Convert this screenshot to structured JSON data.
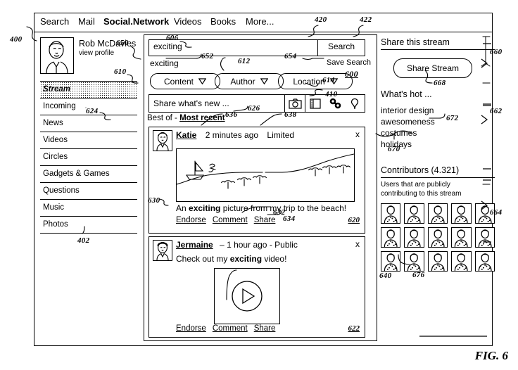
{
  "figure": {
    "label": "FIG. 6",
    "main_ref": "400",
    "panel_ref": "402",
    "center_ref": "600"
  },
  "topnav": {
    "items": [
      {
        "label": "Search",
        "bold": false
      },
      {
        "label": "Mail",
        "bold": false
      },
      {
        "label": "Social.Network",
        "bold": true
      },
      {
        "label": "Videos",
        "bold": false
      },
      {
        "label": "Books",
        "bold": false
      },
      {
        "label": "More...",
        "bold": false
      }
    ],
    "refs": [
      "420",
      "422"
    ]
  },
  "sidebar": {
    "profile": {
      "name": "Rob McDavies",
      "link": "view profile",
      "avatar_icon": "user-portrait-icon"
    },
    "items": [
      {
        "label": "Stream",
        "selected": true
      },
      {
        "label": "Incoming",
        "selected": false
      },
      {
        "label": "News",
        "selected": false
      },
      {
        "label": "Videos",
        "selected": false
      },
      {
        "label": "Circles",
        "selected": false
      },
      {
        "label": "Gadgets & Games",
        "selected": false
      },
      {
        "label": "Questions",
        "selected": false
      },
      {
        "label": "Music",
        "selected": false
      },
      {
        "label": "Photos",
        "selected": false
      }
    ],
    "refs": {
      "profile": "650",
      "stream": "610",
      "incoming": "624"
    }
  },
  "search": {
    "value": "exciting",
    "button_label": "Search",
    "query_echo": "exciting",
    "save_search_label": "Save Search",
    "refs": {
      "field": "606",
      "echo": "652",
      "save": "654"
    }
  },
  "filters": [
    {
      "label": "Content",
      "icon": "chevron-down-icon",
      "ref": ""
    },
    {
      "label": "Author",
      "icon": "chevron-down-icon",
      "ref": "612"
    },
    {
      "label": "Location",
      "icon": "chevron-down-icon",
      "ref": "614"
    }
  ],
  "composer": {
    "placeholder": "Share what's new ...",
    "icons": [
      "camera-icon",
      "video-icon",
      "link-icon",
      "location-pin-icon"
    ],
    "ref": "410"
  },
  "sort": {
    "options": [
      {
        "label": "Best of",
        "selected": false
      },
      {
        "label": "Most recent",
        "selected": true
      }
    ],
    "separator": "-",
    "ref": "626"
  },
  "posts": [
    {
      "author": "Katie",
      "time": "2 minutes ago",
      "audience": "Limited",
      "separator": "",
      "close_icon": "close-icon",
      "avatar_icon": "user-portrait-icon",
      "media_type": "beach-drawing",
      "body_prefix": "An ",
      "body_bold": "exciting",
      "body_suffix": " picture from my trip to the beach!",
      "actions": [
        "Endorse",
        "Comment",
        "Share"
      ],
      "post_ref": "620",
      "refs": {
        "header": "636",
        "audience": "638",
        "body": "630",
        "actions": "632",
        "share": "634"
      }
    },
    {
      "author": "Jermaine",
      "time": "1 hour ago",
      "audience": "Public",
      "separator": "–",
      "close_icon": "close-icon",
      "avatar_icon": "user-portrait-icon",
      "media_type": "video-player",
      "body_prefix": "Check out my ",
      "body_bold": "exciting",
      "body_suffix": " video!",
      "actions": [
        "Endorse",
        "Comment",
        "Share"
      ],
      "post_ref": "622",
      "refs": {
        "media": "640"
      }
    }
  ],
  "right": {
    "share_title": "Share this stream",
    "share_button": "Share Stream",
    "hot_title": "What's hot ...",
    "hot_items": [
      "interior design",
      "awesomeness",
      "costumes",
      "holidays"
    ],
    "contrib_title": "Contributors (4.321)",
    "contrib_sub_line1": "Users that are publicly",
    "contrib_sub_line2": "contributing to this stream",
    "avatar_icon": "user-portrait-icon",
    "avatar_count": 15,
    "refs": {
      "share": "660",
      "share_btn": "668",
      "hot": "662",
      "hot_item": "672",
      "hot_group": "670",
      "contrib": "664",
      "contrib_avatar": "676"
    }
  }
}
